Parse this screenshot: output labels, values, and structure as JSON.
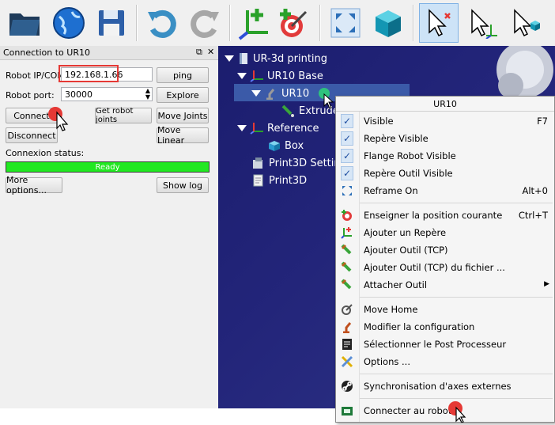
{
  "toolbar": {
    "icons": [
      "open-folder-icon",
      "globe-icon",
      "save-icon",
      "undo-icon",
      "redo-icon",
      "add-frame-icon",
      "add-target-icon",
      "fit-all-icon",
      "box-view-icon",
      "select-cursor-icon",
      "move-reference-icon",
      "move-object-icon"
    ]
  },
  "panel": {
    "title": "Connection to UR10",
    "ip_label": "Robot IP/COM:",
    "ip_value": "192.168.1.66",
    "port_label": "Robot port:",
    "port_value": "30000",
    "ping": "ping",
    "explore": "Explore",
    "connect": "Connect",
    "get_joints": "Get robot joints",
    "move_joints": "Move Joints",
    "disconnect": "Disconnect",
    "move_linear": "Move Linear",
    "status_label": "Connexion status:",
    "status_value": "Ready",
    "more_options": "More options...",
    "show_log": "Show log"
  },
  "tree": {
    "root": "UR-3d printing",
    "base": "UR10 Base",
    "robot": "UR10",
    "tool": "Extrude",
    "reference": "Reference",
    "box": "Box",
    "settings": "Print3D Settin",
    "program": "Print3D"
  },
  "menu": {
    "title": "UR10",
    "items": [
      {
        "label": "Visible",
        "shortcut": "F7"
      },
      {
        "label": "Repère Visible",
        "shortcut": ""
      },
      {
        "label": "Flange Robot Visible",
        "shortcut": ""
      },
      {
        "label": "Repère Outil Visible",
        "shortcut": ""
      },
      {
        "label": "Reframe On",
        "shortcut": "Alt+0"
      },
      {
        "label": "Enseigner la position courante",
        "shortcut": "Ctrl+T"
      },
      {
        "label": "Ajouter un Repère",
        "shortcut": ""
      },
      {
        "label": "Ajouter Outil (TCP)",
        "shortcut": ""
      },
      {
        "label": "Ajouter Outil (TCP) du fichier ...",
        "shortcut": ""
      },
      {
        "label": "Attacher Outil",
        "shortcut": ""
      },
      {
        "label": "Move Home",
        "shortcut": ""
      },
      {
        "label": "Modifier la configuration",
        "shortcut": ""
      },
      {
        "label": "Sélectionner le Post Processeur",
        "shortcut": ""
      },
      {
        "label": "Options ...",
        "shortcut": ""
      },
      {
        "label": "Synchronisation d'axes externes",
        "shortcut": ""
      },
      {
        "label": "Connecter au robot.",
        "shortcut": ""
      }
    ]
  },
  "colors": {
    "status_green": "#22e822",
    "highlight_red": "#e53935",
    "tree_bg": "#1b1d6e"
  }
}
